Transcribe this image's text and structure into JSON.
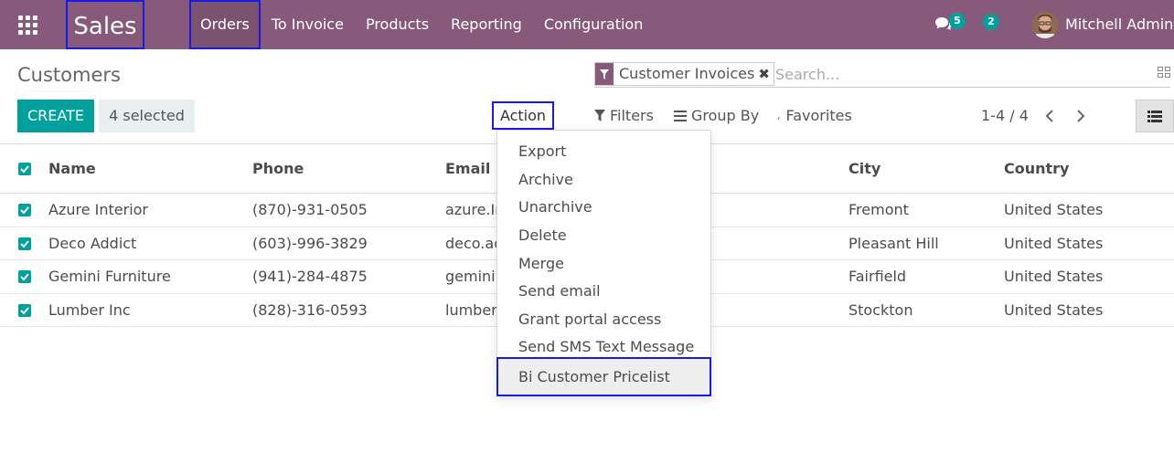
{
  "navbar": {
    "brand": "Sales",
    "menu": [
      {
        "label": "Orders"
      },
      {
        "label": "To Invoice"
      },
      {
        "label": "Products"
      },
      {
        "label": "Reporting"
      },
      {
        "label": "Configuration"
      }
    ],
    "messages_count": "5",
    "activities_count": "2",
    "user_name": "Mitchell Admin"
  },
  "control_panel": {
    "breadcrumb": "Customers",
    "search": {
      "facet_label": "Customer Invoices",
      "placeholder": "Search..."
    },
    "create_label": "CREATE",
    "selected_label": "4 selected",
    "action_label": "Action",
    "filters_label": "Filters",
    "groupby_label": "Group By",
    "favorites_label": "Favorites",
    "pager": "1-4 / 4"
  },
  "table": {
    "columns": {
      "name": "Name",
      "phone": "Phone",
      "email": "Email",
      "city": "City",
      "country": "Country"
    },
    "rows": [
      {
        "name": "Azure Interior",
        "phone": "(870)-931-0505",
        "email": "azure.In",
        "city": "Fremont",
        "country": "United States"
      },
      {
        "name": "Deco Addict",
        "phone": "(603)-996-3829",
        "email": "deco.ad",
        "city": "Pleasant Hill",
        "country": "United States"
      },
      {
        "name": "Gemini Furniture",
        "phone": "(941)-284-4875",
        "email": "gemini",
        "city": "Fairfield",
        "country": "United States"
      },
      {
        "name": "Lumber Inc",
        "phone": "(828)-316-0593",
        "email": "lumber",
        "city": "Stockton",
        "country": "United States"
      }
    ]
  },
  "action_menu": {
    "items": [
      {
        "label": "Export"
      },
      {
        "label": "Archive"
      },
      {
        "label": "Unarchive"
      },
      {
        "label": "Delete"
      },
      {
        "label": "Merge"
      },
      {
        "label": "Send email"
      },
      {
        "label": "Grant portal access"
      },
      {
        "label": "Send SMS Text Message"
      },
      {
        "label": "Bi Customer Pricelist"
      }
    ]
  },
  "colors": {
    "navbar": "#875a7b",
    "primary": "#00a09d",
    "highlight_border": "#1a1ae6"
  }
}
